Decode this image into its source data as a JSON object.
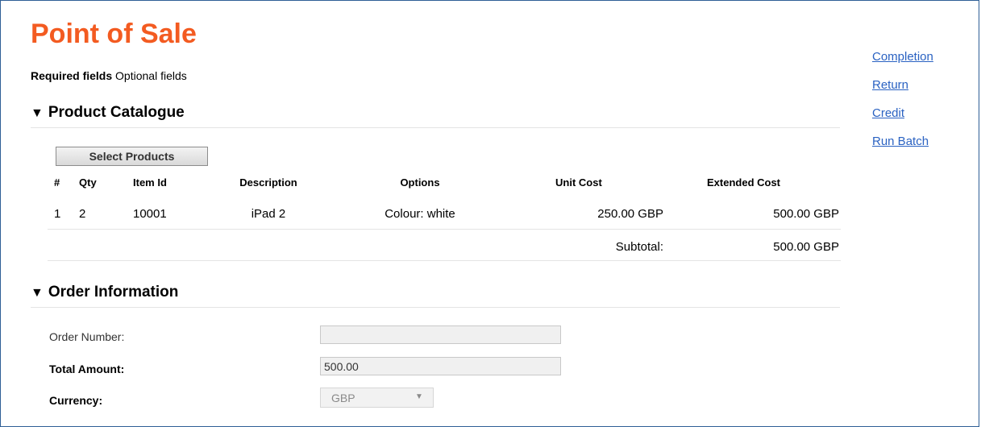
{
  "header": {
    "title": "Point of Sale",
    "required_fields": "Required fields",
    "optional_fields": "Optional fields"
  },
  "sections": {
    "catalogue": "Product Catalogue",
    "order": "Order Information"
  },
  "catalogue": {
    "select_button": "Select Products",
    "columns": [
      "#",
      "Qty",
      "Item Id",
      "Description",
      "Options",
      "Unit Cost",
      "Extended Cost"
    ],
    "rows": [
      {
        "num": "1",
        "qty": "2",
        "item_id": "10001",
        "description": "iPad 2",
        "options": "Colour: white",
        "unit_cost": "250.00 GBP",
        "extended_cost": "500.00 GBP"
      }
    ],
    "subtotal_label": "Subtotal:",
    "subtotal_value": "500.00 GBP"
  },
  "order": {
    "order_number_label": "Order Number:",
    "order_number_value": "",
    "total_amount_label": "Total Amount:",
    "total_amount_value": "500.00",
    "currency_label": "Currency:",
    "currency_value": "GBP"
  },
  "side_links": [
    "Completion",
    "Return",
    "Credit",
    "Run Batch"
  ],
  "colors": {
    "title": "#f35b21",
    "link": "#2a62c2",
    "frame_border": "#2f5f96"
  },
  "icons": {
    "section_toggle": "triangle-down-icon",
    "select_arrow": "chevron-down-icon"
  }
}
